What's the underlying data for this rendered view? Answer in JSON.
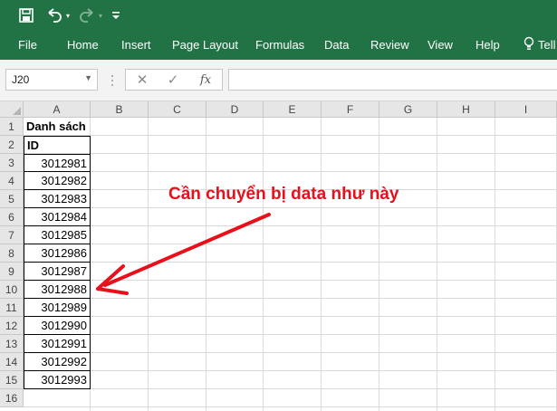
{
  "name_box": {
    "value": "J20"
  },
  "formula_bar": {
    "cancel_symbol": "✕",
    "enter_symbol": "✓",
    "fx_symbol": "fx",
    "content": ""
  },
  "ribbon_tabs": [
    "File",
    "Home",
    "Insert",
    "Page Layout",
    "Formulas",
    "Data",
    "Review",
    "View",
    "Help",
    "Tell"
  ],
  "columns": [
    "A",
    "B",
    "C",
    "D",
    "E",
    "F",
    "G",
    "H",
    "I"
  ],
  "rows": [
    "1",
    "2",
    "3",
    "4",
    "5",
    "6",
    "7",
    "8",
    "9",
    "10",
    "11",
    "12",
    "13",
    "14",
    "15",
    "16"
  ],
  "sheet": {
    "a1": "Danh sách",
    "a2": "ID",
    "ids": [
      "3012981",
      "3012982",
      "3012983",
      "3012984",
      "3012985",
      "3012986",
      "3012987",
      "3012988",
      "3012989",
      "3012990",
      "3012991",
      "3012992",
      "3012993"
    ]
  },
  "annotation": {
    "text": "Cần chuyển bị data như này",
    "color": "#e8101a"
  },
  "colors": {
    "excel_green": "#217346",
    "header_gray": "#e6e6e6",
    "gridline": "#dadada"
  },
  "icons": [
    "save-icon",
    "undo-icon",
    "redo-icon",
    "customize-qat-icon",
    "lightbulb-icon"
  ]
}
